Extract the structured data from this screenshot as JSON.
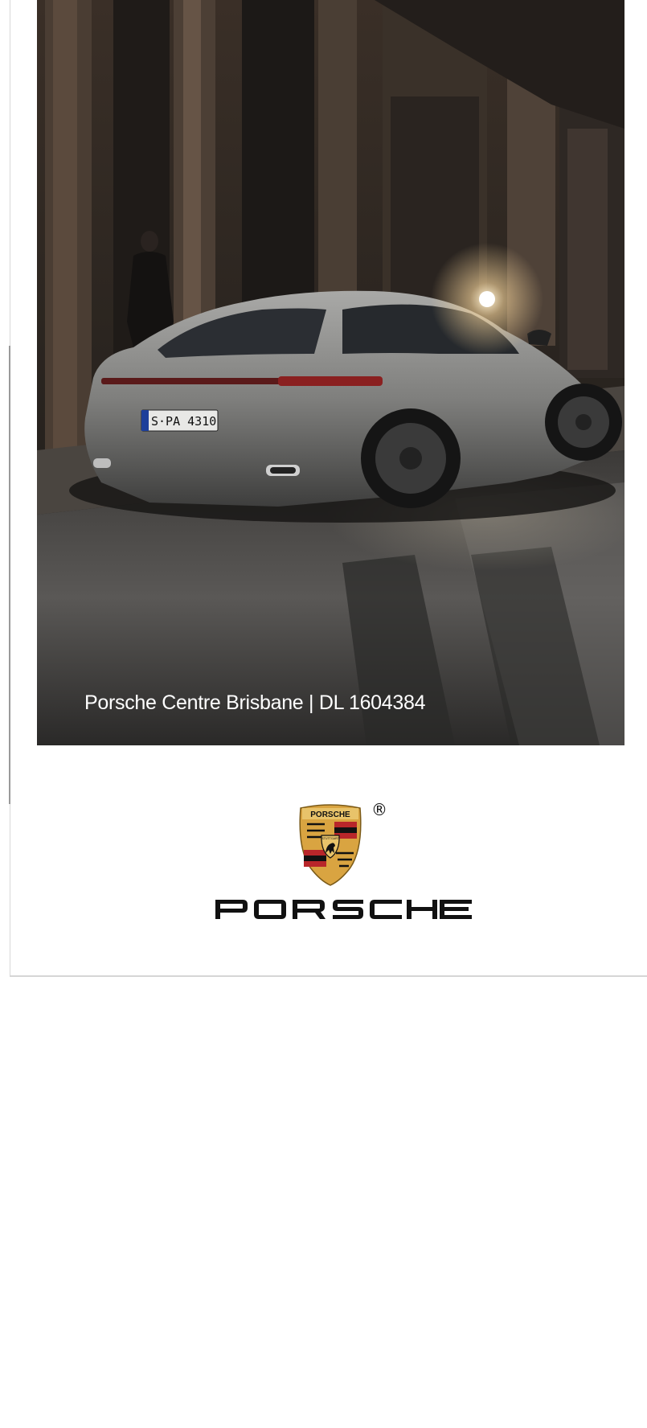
{
  "hero": {
    "caption": "Porsche Centre Brisbane | DL 1604384",
    "plate": "S·PA 4310"
  },
  "brand": {
    "crest_text": "PORSCHE",
    "crest_city": "STUTTGART",
    "registered_mark": "®",
    "wordmark": "PORSCHE"
  },
  "colors": {
    "crest_gold": "#d9a441",
    "crest_red": "#b8262a",
    "crest_black": "#111111",
    "caption_text": "#ffffff",
    "page_bg": "#ffffff"
  },
  "icons": {
    "crest": "porsche-crest-icon",
    "registered": "registered-trademark-icon"
  }
}
